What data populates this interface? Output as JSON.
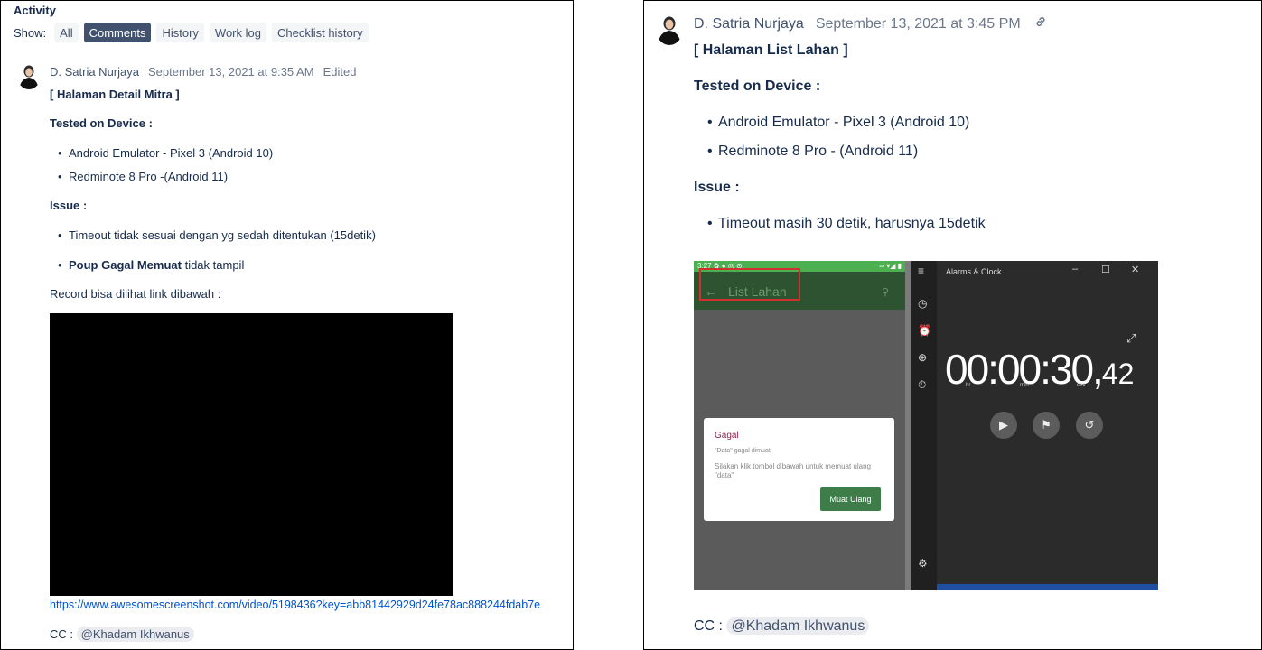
{
  "left": {
    "activity_title": "Activity",
    "show_label": "Show:",
    "filters": [
      {
        "label": "All",
        "active": false
      },
      {
        "label": "Comments",
        "active": true
      },
      {
        "label": "History",
        "active": false
      },
      {
        "label": "Work log",
        "active": false
      },
      {
        "label": "Checklist history",
        "active": false
      }
    ],
    "comment": {
      "author": "D. Satria Nurjaya",
      "timestamp": "September 13, 2021 at 9:35 AM",
      "edited": "Edited",
      "heading": "[ Halaman Detail Mitra ]",
      "tested_label": "Tested on Device :",
      "devices": [
        "Android Emulator - Pixel 3 (Android 10)",
        "Redminote 8 Pro -(Android 11)"
      ],
      "issue_label": "Issue :",
      "issue_1": "Timeout tidak sesuai dengan yg sedah ditentukan (15detik)",
      "issue_2_bold": "Poup Gagal Memuat",
      "issue_2_rest": " tidak tampil",
      "record_text": "Record bisa dilihat link dibawah :",
      "link": "https://www.awesomescreenshot.com/video/5198436?key=abb81442929d24fe78ac888244fdab7e",
      "cc_label": "CC :",
      "mention": "@Khadam Ikhwanus"
    }
  },
  "right": {
    "comment": {
      "author": "D. Satria Nurjaya",
      "timestamp": "September 13, 2021 at 3:45 PM",
      "heading": "[ Halaman List Lahan ]",
      "tested_label": "Tested on Device :",
      "devices": [
        "Android Emulator - Pixel 3 (Android 10)",
        "Redminote 8 Pro - (Android 11)"
      ],
      "issue_label": "Issue :",
      "issues": [
        "Timeout masih 30 detik, harusnya 15detik"
      ],
      "cc_label": "CC :",
      "mention": "@Khadam Ikhwanus"
    },
    "screenshot": {
      "phone_status": "3:27 ✿ ● ◎ ⊙",
      "phone_status_right": "∞ ▾◢ ▮",
      "app_title": "List Lahan",
      "dialog_title": "Gagal",
      "dialog_sub": "\"Data\" gagal dimuat",
      "dialog_body": "Silakan klik tombol dibawah untuk memuat ulang \"data\"",
      "dialog_button": "Muat Ulang",
      "alarm_app_title": "Alarms & Clock",
      "timer_main": "00:00:30,",
      "timer_frac": "42",
      "unit_hr": "hr",
      "unit_min": "min",
      "unit_sec": "sec"
    }
  },
  "colors": {
    "accent": "#0052cc",
    "active_filter": "#42526e",
    "text": "#172b4d"
  }
}
